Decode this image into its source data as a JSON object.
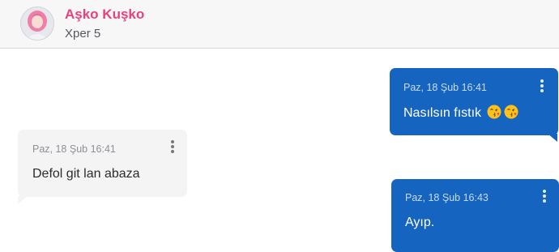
{
  "contact": {
    "name": "Aşko Kuşko",
    "subtitle": "Xper 5"
  },
  "messages": [
    {
      "direction": "outgoing",
      "time": "Paz, 18 Şub 16:41",
      "text": "Nasılsın fıstık",
      "emoji": [
        "kissing-face-icon",
        "kissing-face-icon"
      ]
    },
    {
      "direction": "incoming",
      "time": "Paz, 18 Şub 16:41",
      "text": "Defol git lan abaza"
    },
    {
      "direction": "outgoing",
      "time": "Paz, 18 Şub 16:43",
      "text": "Ayıp."
    }
  ],
  "colors": {
    "header_bg": "#f7f7f8",
    "contact_name": "#ec407a",
    "outgoing_bubble": "#1565c0",
    "incoming_bubble": "#f4f4f5"
  }
}
